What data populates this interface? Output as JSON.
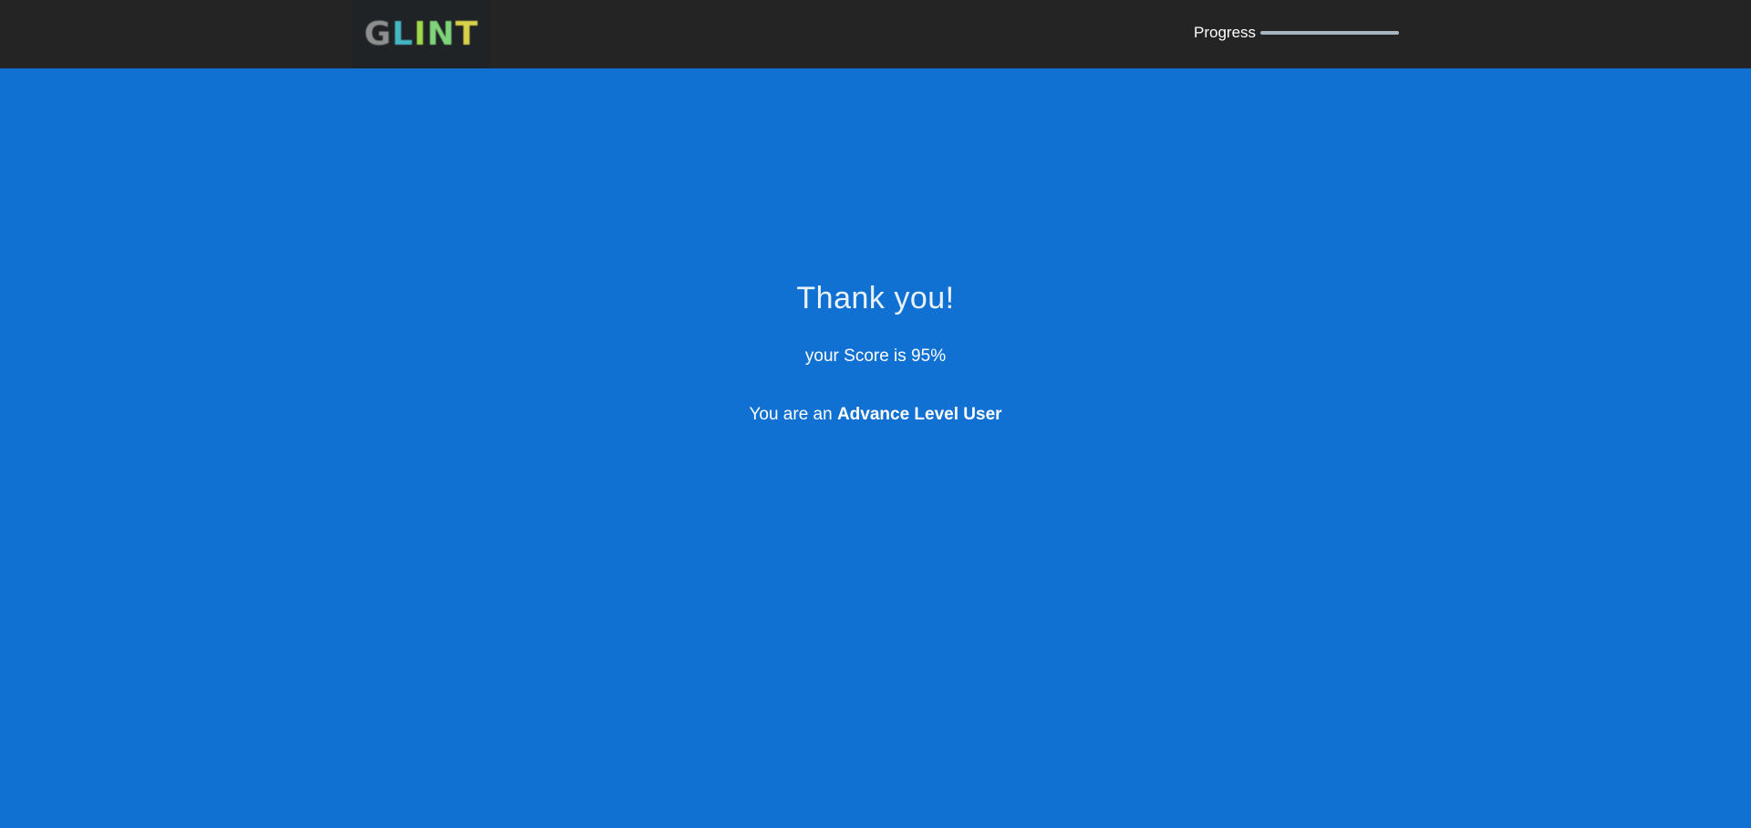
{
  "header": {
    "logo": {
      "letters": [
        "G",
        "L",
        "I",
        "N",
        "T"
      ],
      "colors": [
        "#8f8f8f",
        "#44b8c2",
        "#a0d84a",
        "#7fd37a",
        "#d8d24a"
      ]
    },
    "progress": {
      "label": "Progress",
      "value_percent": 100
    }
  },
  "result": {
    "title": "Thank you!",
    "score_text": "your Score is 95%",
    "level_prefix": "You are an ",
    "level_name": "Advance Level User"
  },
  "colors": {
    "background": "#1171d2",
    "topbar": "#242424",
    "text": "#ffffff"
  }
}
